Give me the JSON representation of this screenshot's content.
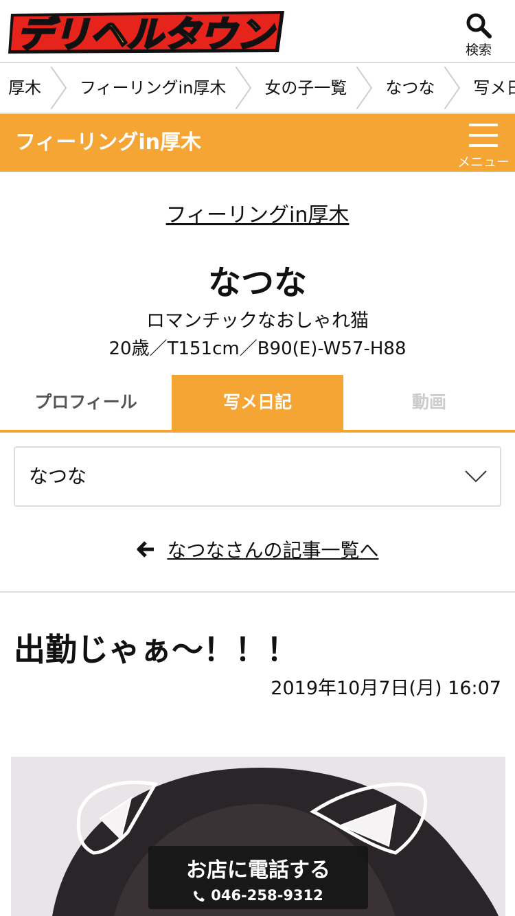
{
  "header": {
    "logo_text": "デリヘルタウン",
    "search_label": "検索"
  },
  "breadcrumb": {
    "items": [
      "厚木",
      "フィーリングin厚木",
      "女の子一覧",
      "なつな",
      "写メ日記"
    ]
  },
  "shop_bar": {
    "title": "フィーリングin厚木",
    "menu_label": "メニュー"
  },
  "profile": {
    "shop_link": "フィーリングin厚木",
    "name": "なつな",
    "catch_copy": "ロマンチックなおしゃれ猫",
    "spec": "20歳／T151cm／B90(E)-W57-H88"
  },
  "tabs": [
    {
      "label": "プロフィール",
      "state": "normal"
    },
    {
      "label": "写メ日記",
      "state": "active"
    },
    {
      "label": "動画",
      "state": "disabled"
    }
  ],
  "girl_select": {
    "value": "なつな"
  },
  "back_link": {
    "label": "なつなさんの記事一覧へ"
  },
  "article": {
    "title": "出勤じゃぁ〜！！！",
    "date": "2019年10月7日(月) 16:07"
  },
  "call_button": {
    "title": "お店に電話する",
    "phone": "046-258-9312"
  },
  "colors": {
    "accent": "#f4a533",
    "logo_yellow": "#ffd400",
    "logo_red": "#e6241b"
  }
}
